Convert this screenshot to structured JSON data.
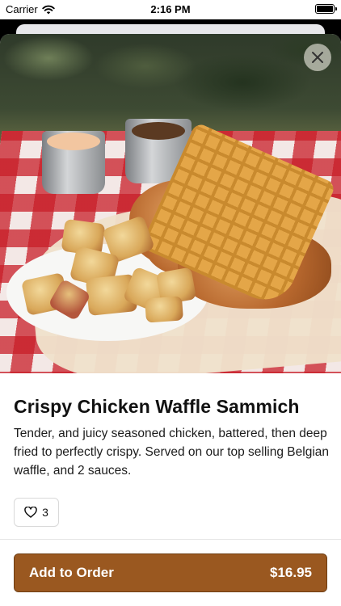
{
  "status_bar": {
    "carrier": "Carrier",
    "time": "2:16 PM",
    "icons": [
      "wifi-icon",
      "battery-icon"
    ],
    "battery_level": 1.0
  },
  "item": {
    "title": "Crispy Chicken Waffle Sammich",
    "description": "Tender, and juicy seasoned chicken, battered, then deep fried to perfectly crispy. Served on our top selling Belgian waffle, and 2 sauces.",
    "likes": "3",
    "price": "$16.95"
  },
  "actions": {
    "close_icon": "close-icon",
    "like_icon": "heart-outline-icon",
    "add_label": "Add to Order"
  },
  "colors": {
    "accent": "#9a5820",
    "accent_border": "#6e3d12",
    "text": "#111111"
  }
}
